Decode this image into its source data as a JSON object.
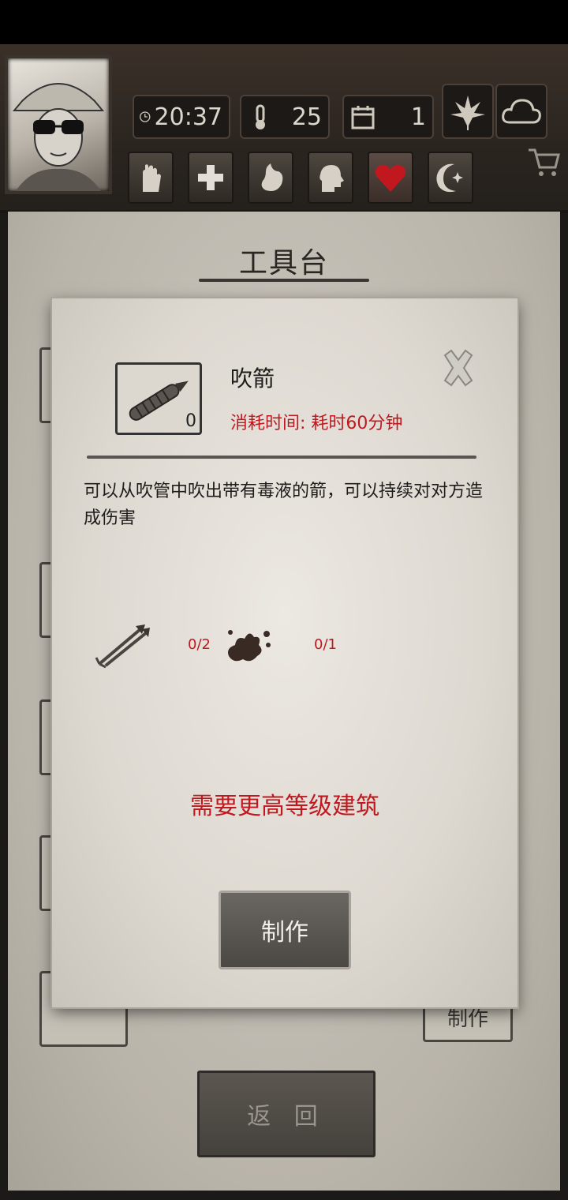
{
  "hud": {
    "time": "20:37",
    "temperature": "25",
    "day": "1",
    "icons": [
      "clock-icon",
      "thermometer-icon",
      "calendar-icon",
      "leaf-icon",
      "cloud-icon"
    ],
    "toolbar": [
      "hand-icon",
      "health-cross-icon",
      "stomach-icon",
      "head-icon",
      "heart-icon",
      "moon-icon"
    ],
    "cart": "cart-icon"
  },
  "panel": {
    "title": "工具台",
    "return_label": "返 回",
    "background_make_label": "制作"
  },
  "modal": {
    "item_name": "吹箭",
    "item_count": "0",
    "time_cost": "消耗时间: 耗时60分钟",
    "description": "可以从吹管中吹出带有毒液的箭，可以持续对对方造成伤害",
    "materials": [
      {
        "icon": "arrows-icon",
        "count": "0/2"
      },
      {
        "icon": "poison-splat-icon",
        "count": "0/1"
      }
    ],
    "requirement": "需要更高等级建筑",
    "craft_label": "制作"
  },
  "colors": {
    "accent_red": "#c0181e",
    "paper": "#ddd8d0",
    "frame": "#2b2520"
  }
}
